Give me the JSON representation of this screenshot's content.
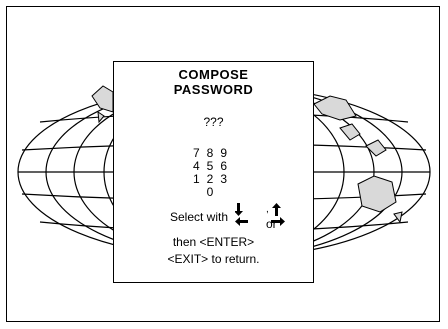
{
  "dialog": {
    "title_line1": "COMPOSE",
    "title_line2": "PASSWORD",
    "password_mask": "???",
    "keypad_rows": [
      "789",
      "456",
      "123",
      "0"
    ],
    "select_with": "Select with",
    "comma": ",",
    "or_label": "or",
    "enter_line": "then <ENTER>",
    "exit_line": "<EXIT> to return."
  },
  "icons": {
    "background": "world-map-globe-icon",
    "arrow_down_left": "arrow-down-left-icon",
    "arrow_up_right": "arrow-up-right-icon"
  },
  "colors": {
    "line": "#000000",
    "land": "#d9d9d9",
    "background": "#ffffff"
  }
}
